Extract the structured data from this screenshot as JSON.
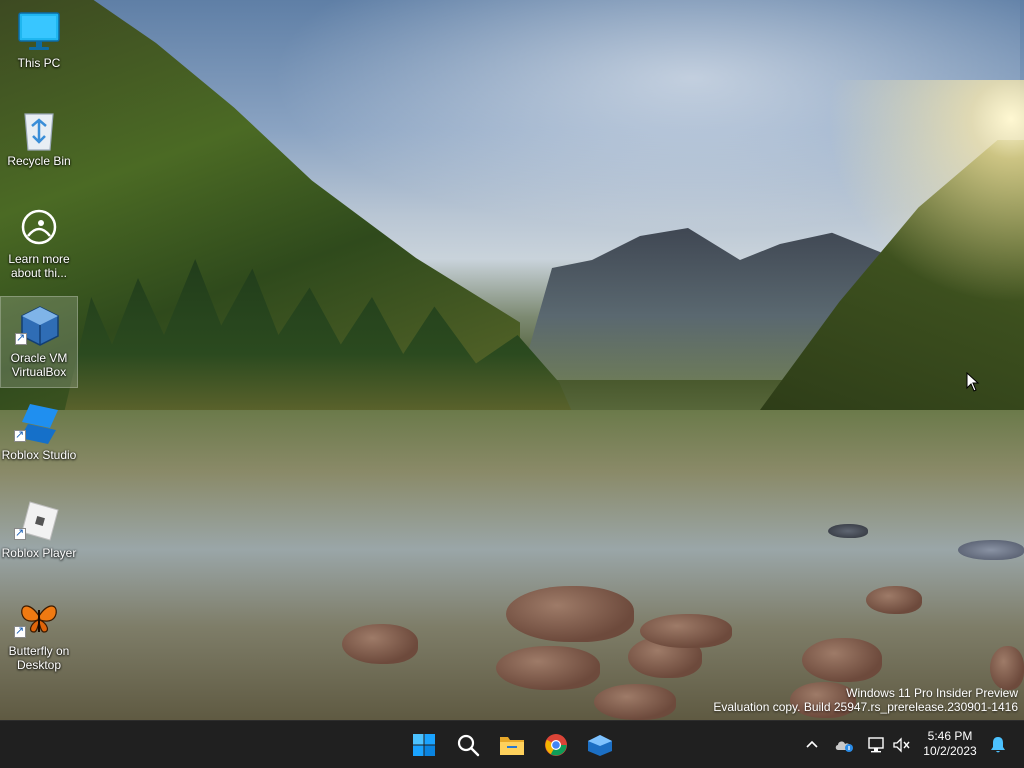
{
  "desktop": {
    "icons": [
      {
        "label": "This PC",
        "icon": "monitor-icon"
      },
      {
        "label": "Recycle Bin",
        "icon": "recycle-bin-icon"
      },
      {
        "label": "Learn more about thi...",
        "icon": "learn-more-icon"
      },
      {
        "label": "Oracle VM VirtualBox",
        "icon": "virtualbox-icon"
      },
      {
        "label": "Roblox Studio",
        "icon": "roblox-studio-icon"
      },
      {
        "label": "Roblox Player",
        "icon": "roblox-player-icon"
      },
      {
        "label": "Butterfly on Desktop",
        "icon": "butterfly-icon"
      }
    ]
  },
  "watermark": {
    "line1": "Windows 11 Pro Insider Preview",
    "line2": "Evaluation copy. Build 25947.rs_prerelease.230901-1416"
  },
  "taskbar": {
    "pinned": [
      {
        "name": "start",
        "icon": "windows-start-icon"
      },
      {
        "name": "search",
        "icon": "search-icon"
      },
      {
        "name": "file-explorer",
        "icon": "folder-icon"
      },
      {
        "name": "chrome",
        "icon": "chrome-icon"
      },
      {
        "name": "virtualbox",
        "icon": "virtualbox-icon"
      }
    ],
    "tray": {
      "icons": [
        "chevron-up-icon",
        "onedrive-icon",
        "network-icon",
        "volume-muted-icon"
      ],
      "time": "5:46 PM",
      "date": "10/2/2023",
      "notification_icon": "bell-icon"
    }
  },
  "colors": {
    "taskbar_bg": "#202020",
    "start_blue": "#0078d4"
  }
}
